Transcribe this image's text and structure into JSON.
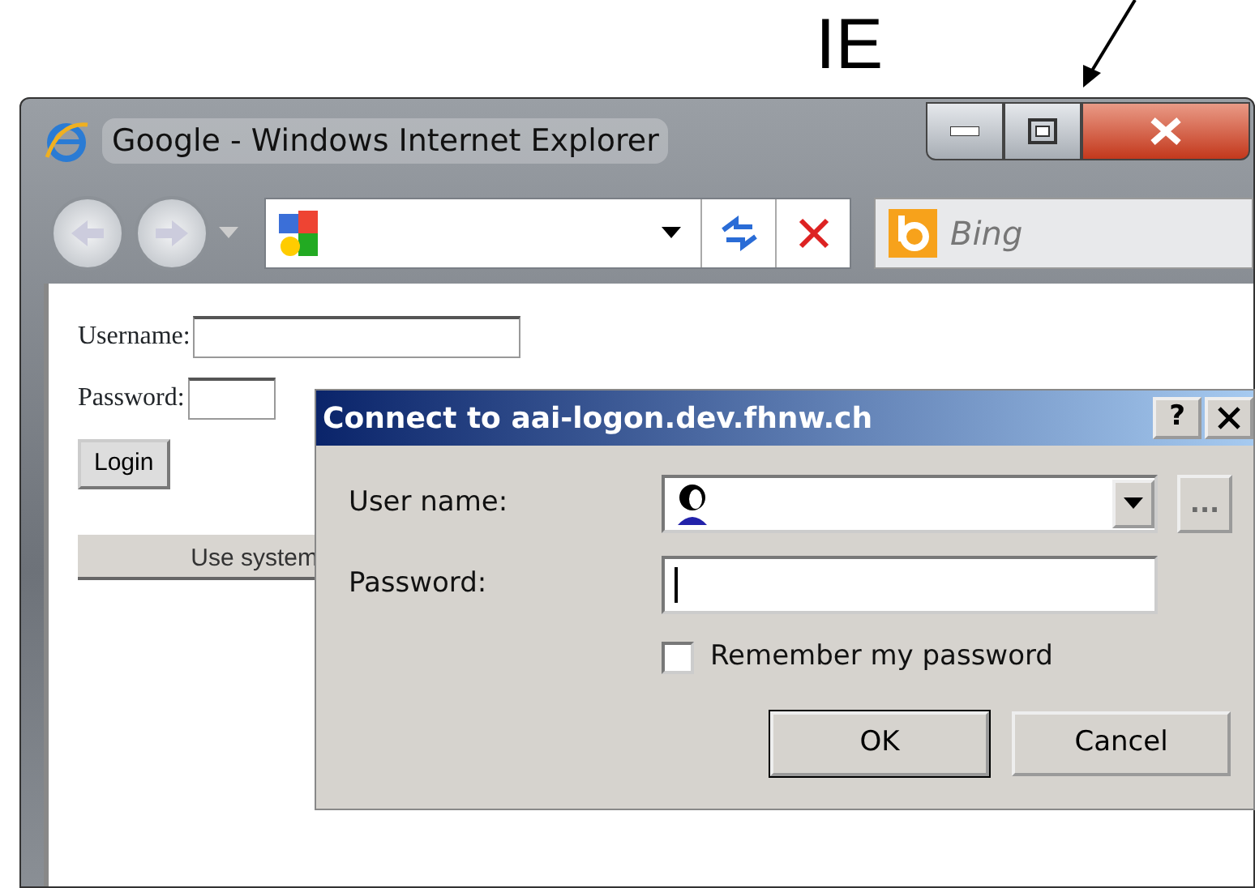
{
  "annotation": {
    "label": "IE"
  },
  "window": {
    "title": "Google - Windows Internet Explorer"
  },
  "search": {
    "placeholder": "Bing"
  },
  "page": {
    "username_label": "Username:",
    "password_label": "Password:",
    "login_button": "Login",
    "system_button": "Use system"
  },
  "dialog": {
    "title": "Connect to aai-logon.dev.fhnw.ch",
    "help": "?",
    "fields": [
      {
        "label": "User name:",
        "kind": "combo"
      },
      {
        "label": "Password:",
        "kind": "password"
      }
    ],
    "browse_button": {
      "label": "...",
      "disabled": true
    },
    "remember": {
      "label": "Remember my password",
      "checked": false
    },
    "buttons": [
      "OK",
      "Cancel"
    ]
  }
}
